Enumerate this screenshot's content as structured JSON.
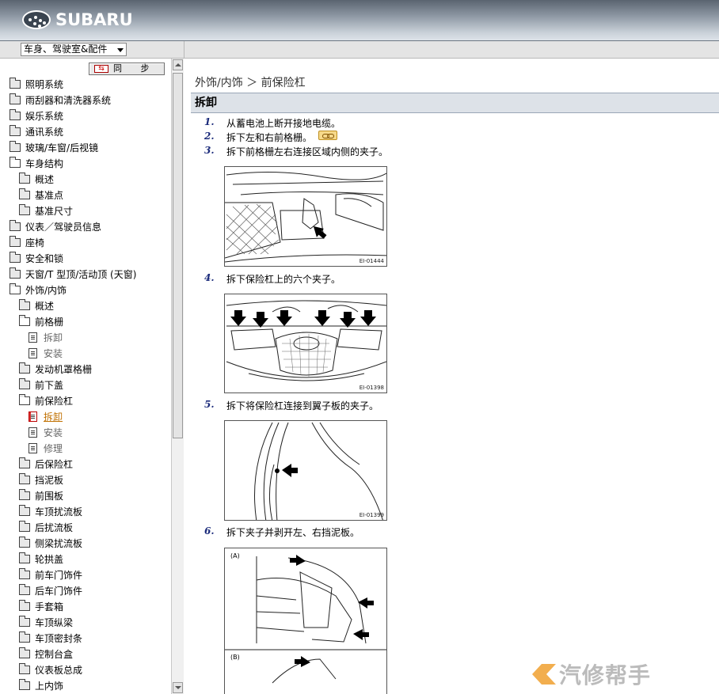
{
  "app": {
    "brand": "SUBARU"
  },
  "category_select": {
    "value": "车身、驾驶室&配件"
  },
  "sync_button": {
    "icon": "⇆",
    "label": "同 步"
  },
  "tree": [
    {
      "label": "照明系统",
      "type": "folder",
      "level": 0
    },
    {
      "label": "雨刮器和清洗器系统",
      "type": "folder",
      "level": 0
    },
    {
      "label": "娱乐系统",
      "type": "folder",
      "level": 0
    },
    {
      "label": "通讯系统",
      "type": "folder",
      "level": 0
    },
    {
      "label": "玻璃/车窗/后视镜",
      "type": "folder",
      "level": 0
    },
    {
      "label": "车身结构",
      "type": "folder-open",
      "level": 0
    },
    {
      "label": "概述",
      "type": "folder",
      "level": 1
    },
    {
      "label": "基准点",
      "type": "folder",
      "level": 1
    },
    {
      "label": "基准尺寸",
      "type": "folder",
      "level": 1
    },
    {
      "label": "仪表／驾驶员信息",
      "type": "folder",
      "level": 0
    },
    {
      "label": "座椅",
      "type": "folder",
      "level": 0
    },
    {
      "label": "安全和锁",
      "type": "folder",
      "level": 0
    },
    {
      "label": "天窗/T 型顶/活动顶 (天窗)",
      "type": "folder",
      "level": 0
    },
    {
      "label": "外饰/内饰",
      "type": "folder-open",
      "level": 0
    },
    {
      "label": "概述",
      "type": "folder",
      "level": 1
    },
    {
      "label": "前格栅",
      "type": "folder-open",
      "level": 1
    },
    {
      "label": "拆卸",
      "type": "doc",
      "level": 2,
      "style": "gray"
    },
    {
      "label": "安装",
      "type": "doc",
      "level": 2,
      "style": "gray"
    },
    {
      "label": "发动机罩格栅",
      "type": "folder",
      "level": 1
    },
    {
      "label": "前下盖",
      "type": "folder",
      "level": 1
    },
    {
      "label": "前保险杠",
      "type": "folder-open",
      "level": 1
    },
    {
      "label": "拆卸",
      "type": "doc-active",
      "level": 2,
      "style": "active"
    },
    {
      "label": "安装",
      "type": "doc",
      "level": 2,
      "style": "gray"
    },
    {
      "label": "修理",
      "type": "doc",
      "level": 2,
      "style": "gray"
    },
    {
      "label": "后保险杠",
      "type": "folder",
      "level": 1
    },
    {
      "label": "挡泥板",
      "type": "folder",
      "level": 1
    },
    {
      "label": "前围板",
      "type": "folder",
      "level": 1
    },
    {
      "label": "车顶扰流板",
      "type": "folder",
      "level": 1
    },
    {
      "label": "后扰流板",
      "type": "folder",
      "level": 1
    },
    {
      "label": "侧梁扰流板",
      "type": "folder",
      "level": 1
    },
    {
      "label": "轮拱盖",
      "type": "folder",
      "level": 1
    },
    {
      "label": "前车门饰件",
      "type": "folder",
      "level": 1
    },
    {
      "label": "后车门饰件",
      "type": "folder",
      "level": 1
    },
    {
      "label": "手套箱",
      "type": "folder",
      "level": 1
    },
    {
      "label": "车顶纵梁",
      "type": "folder",
      "level": 1
    },
    {
      "label": "车顶密封条",
      "type": "folder",
      "level": 1
    },
    {
      "label": "控制台盒",
      "type": "folder",
      "level": 1
    },
    {
      "label": "仪表板总成",
      "type": "folder",
      "level": 1
    },
    {
      "label": "上内饰",
      "type": "folder",
      "level": 1
    }
  ],
  "content": {
    "breadcrumb": "外饰/内饰 ＞ 前保险杠",
    "section_title": "拆卸",
    "steps": [
      {
        "num": "1.",
        "text": "从蓄电池上断开接地电缆。"
      },
      {
        "num": "2.",
        "text": "拆下左和右前格栅。"
      },
      {
        "num": "3.",
        "text": "拆下前格栅左右连接区域内侧的夹子。"
      },
      {
        "num": "4.",
        "text": "拆下保险杠上的六个夹子。"
      },
      {
        "num": "5.",
        "text": "拆下将保险杠连接到翼子板的夹子。"
      },
      {
        "num": "6.",
        "text": "拆下夹子并剥开左、右挡泥板。"
      }
    ],
    "figures": [
      {
        "code": "EI-01444"
      },
      {
        "code": "EI-01398"
      },
      {
        "code": "EI-01399"
      },
      {
        "labels": [
          "(A)",
          "(B)"
        ]
      }
    ]
  },
  "watermark": {
    "text": "汽修帮手"
  }
}
